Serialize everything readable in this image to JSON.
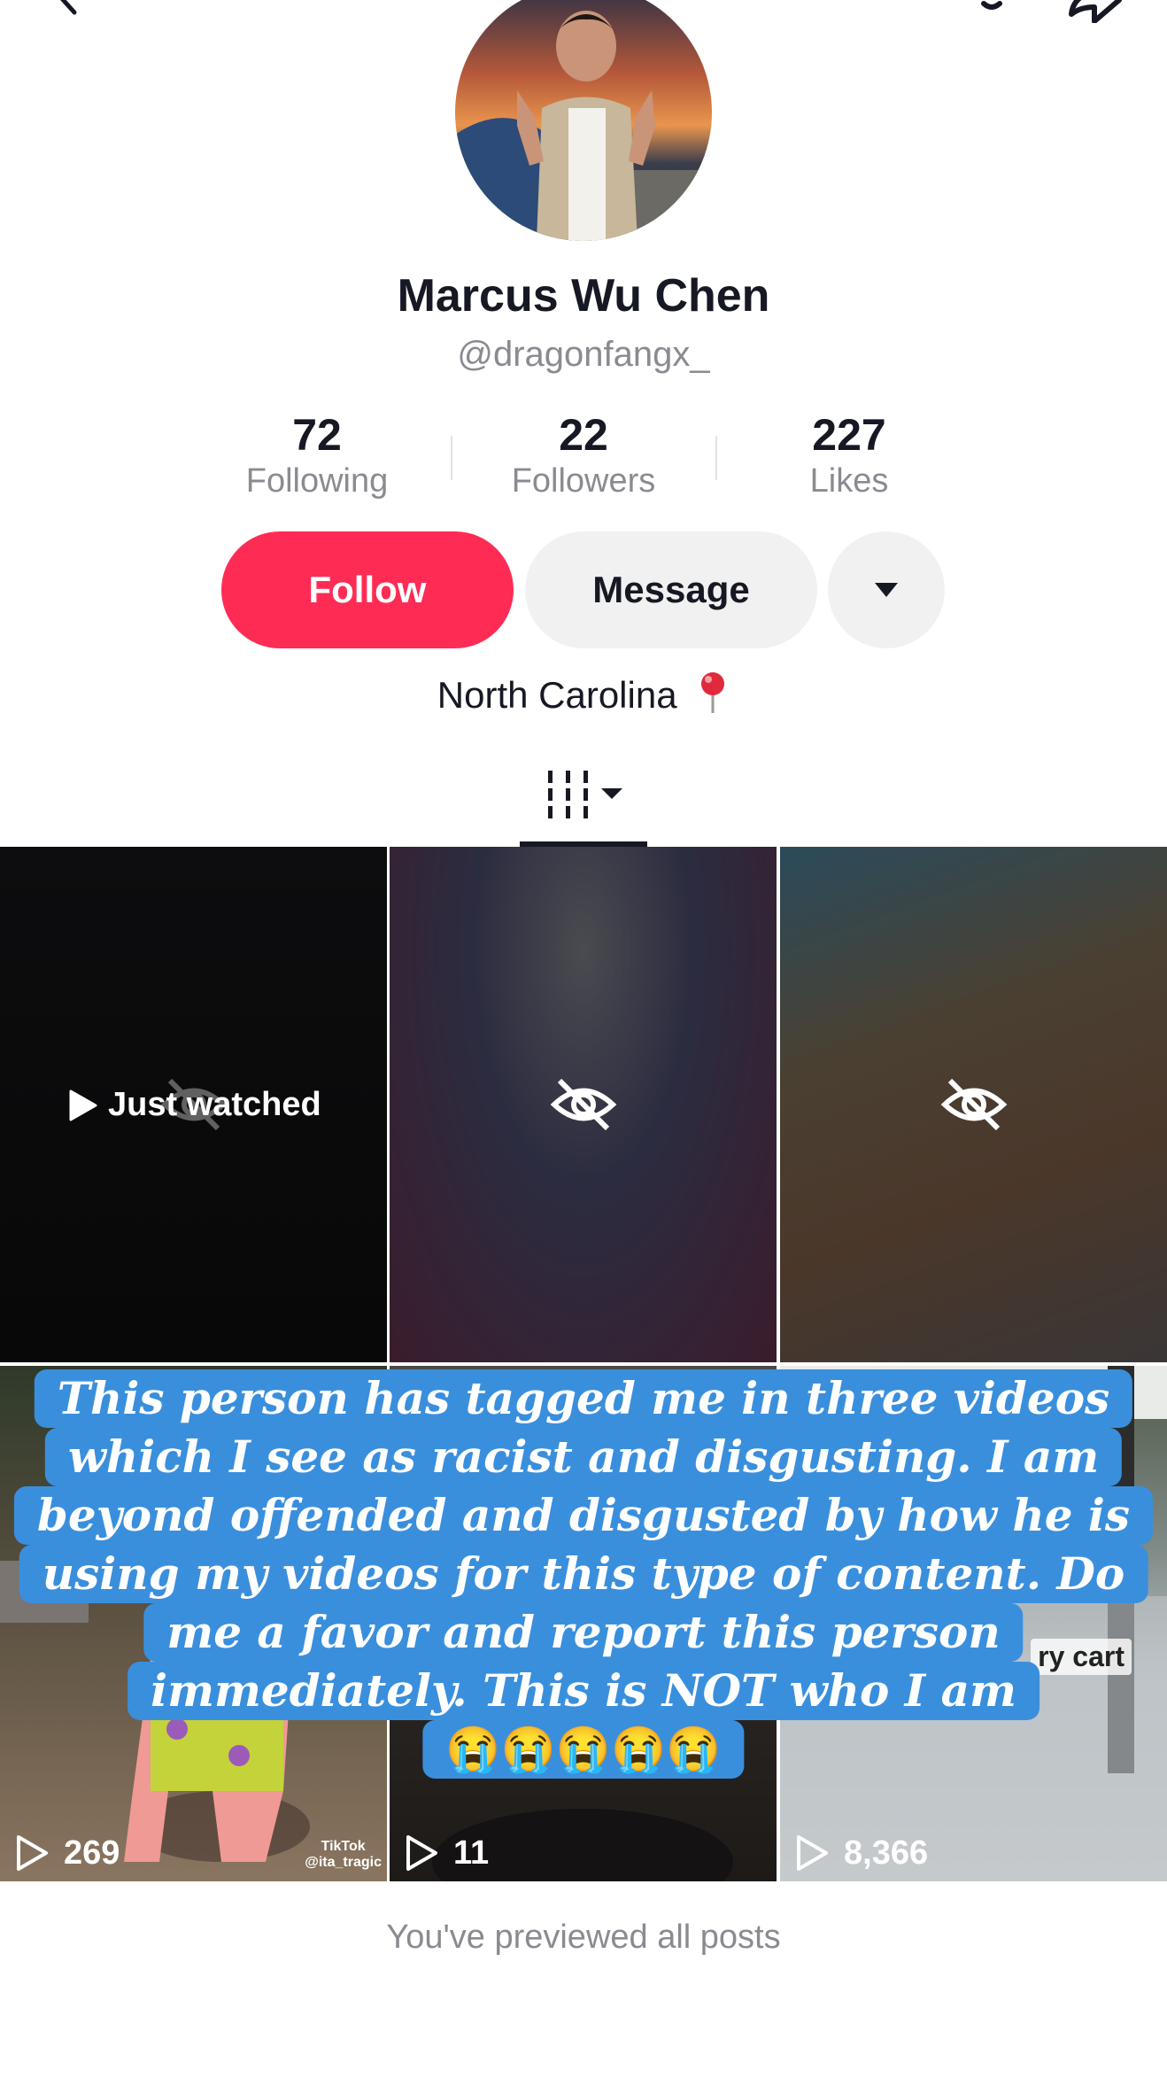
{
  "profile": {
    "name": "Marcus Wu Chen",
    "handle": "@dragonfangx_",
    "bio": "North Carolina"
  },
  "stats": [
    {
      "value": "72",
      "label": "Following"
    },
    {
      "value": "22",
      "label": "Followers"
    },
    {
      "value": "227",
      "label": "Likes"
    }
  ],
  "actions": {
    "follow": "Follow",
    "message": "Message"
  },
  "icons": [
    "back-icon",
    "bell-icon",
    "share-icon",
    "chevron-down-icon",
    "pin-icon",
    "grid-filter-icon",
    "eye-slash-icon",
    "play-icon"
  ],
  "colors": {
    "accent": "#fe2c55",
    "caption_bg": "#3a8fdd"
  },
  "posts": {
    "just_watched": "Just watched",
    "views": [
      "269",
      "11",
      "8,366"
    ],
    "cart_text": "ry cart",
    "watermark": "TikTok",
    "watermark_user": "@ita_tragic"
  },
  "caption": {
    "lines": [
      "This person has tagged me in three videos",
      "which I see as racist and disgusting. I am",
      "beyond offended and disgusted by how he is",
      "using my videos for this type of content. Do",
      "me a favor and report this person",
      "immediately. This is NOT who I am",
      "😭😭😭😭😭"
    ]
  },
  "footer": "You've previewed all posts"
}
